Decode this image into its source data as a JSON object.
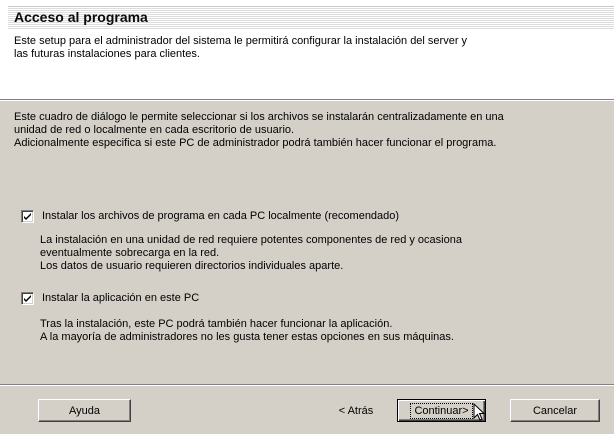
{
  "header": {
    "title": "Acceso al programa",
    "subtitle_lines": [
      "Este setup para el administrador del sistema le permitirá configurar la instalación del server y",
      "las futuras instalaciones para clientes."
    ]
  },
  "intro_lines": [
    "Este cuadro de diálogo le permite seleccionar si los archivos se instalarán centralizadamente en una",
    "unidad de red o localmente en cada escritorio de usuario.",
    "Adicionalmente especifica si este PC de administrador podrá también hacer funcionar el programa."
  ],
  "options": [
    {
      "label": "Instalar los archivos de programa en cada PC localmente (recomendado)",
      "checked": true,
      "description_lines": [
        "La instalación en una unidad de red requiere potentes componentes de red y ocasiona",
        "eventualmente sobrecarga en la red.",
        "Los datos de usuario requieren directorios individuales aparte."
      ]
    },
    {
      "label": "Instalar la aplicación en este PC",
      "checked": true,
      "description_lines": [
        "Tras la instalación, este PC podrá también hacer funcionar la aplicación.",
        "A la mayoría de administradores no les gusta tener estas opciones en sus máquinas."
      ]
    }
  ],
  "buttons": {
    "help": "Ayuda",
    "back": "< Atrás",
    "continue": "Continuar>",
    "cancel": "Cancelar"
  }
}
